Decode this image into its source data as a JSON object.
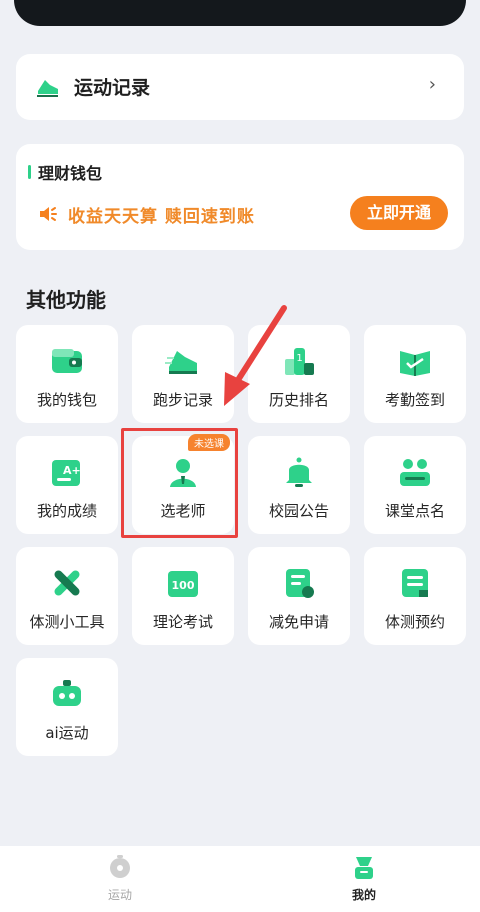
{
  "exercise_record": {
    "title": "运动记录",
    "chevron": "›"
  },
  "wallet": {
    "title": "理财钱包",
    "promo": "收益天天算  赎回速到账",
    "button": "立即开通"
  },
  "section_title": "其他功能",
  "functions": [
    {
      "label": "我的钱包",
      "icon": "wallet-icon"
    },
    {
      "label": "跑步记录",
      "icon": "running-shoe-icon"
    },
    {
      "label": "历史排名",
      "icon": "ranking-icon"
    },
    {
      "label": "考勤签到",
      "icon": "attendance-icon"
    },
    {
      "label": "我的成绩",
      "icon": "grade-icon"
    },
    {
      "label": "选老师",
      "icon": "teacher-icon",
      "badge": "未选课"
    },
    {
      "label": "校园公告",
      "icon": "bell-icon"
    },
    {
      "label": "课堂点名",
      "icon": "roll-call-icon"
    },
    {
      "label": "体测小工具",
      "icon": "tools-icon"
    },
    {
      "label": "理论考试",
      "icon": "exam-icon"
    },
    {
      "label": "减免申请",
      "icon": "exemption-icon"
    },
    {
      "label": "体测预约",
      "icon": "reservation-icon"
    },
    {
      "label": "ai运动",
      "icon": "robot-icon"
    }
  ],
  "tabbar": {
    "sport": "运动",
    "mine": "我的"
  },
  "colors": {
    "accent_green": "#2ed18a",
    "accent_orange": "#f5801e",
    "highlight_red": "#e8423f"
  }
}
